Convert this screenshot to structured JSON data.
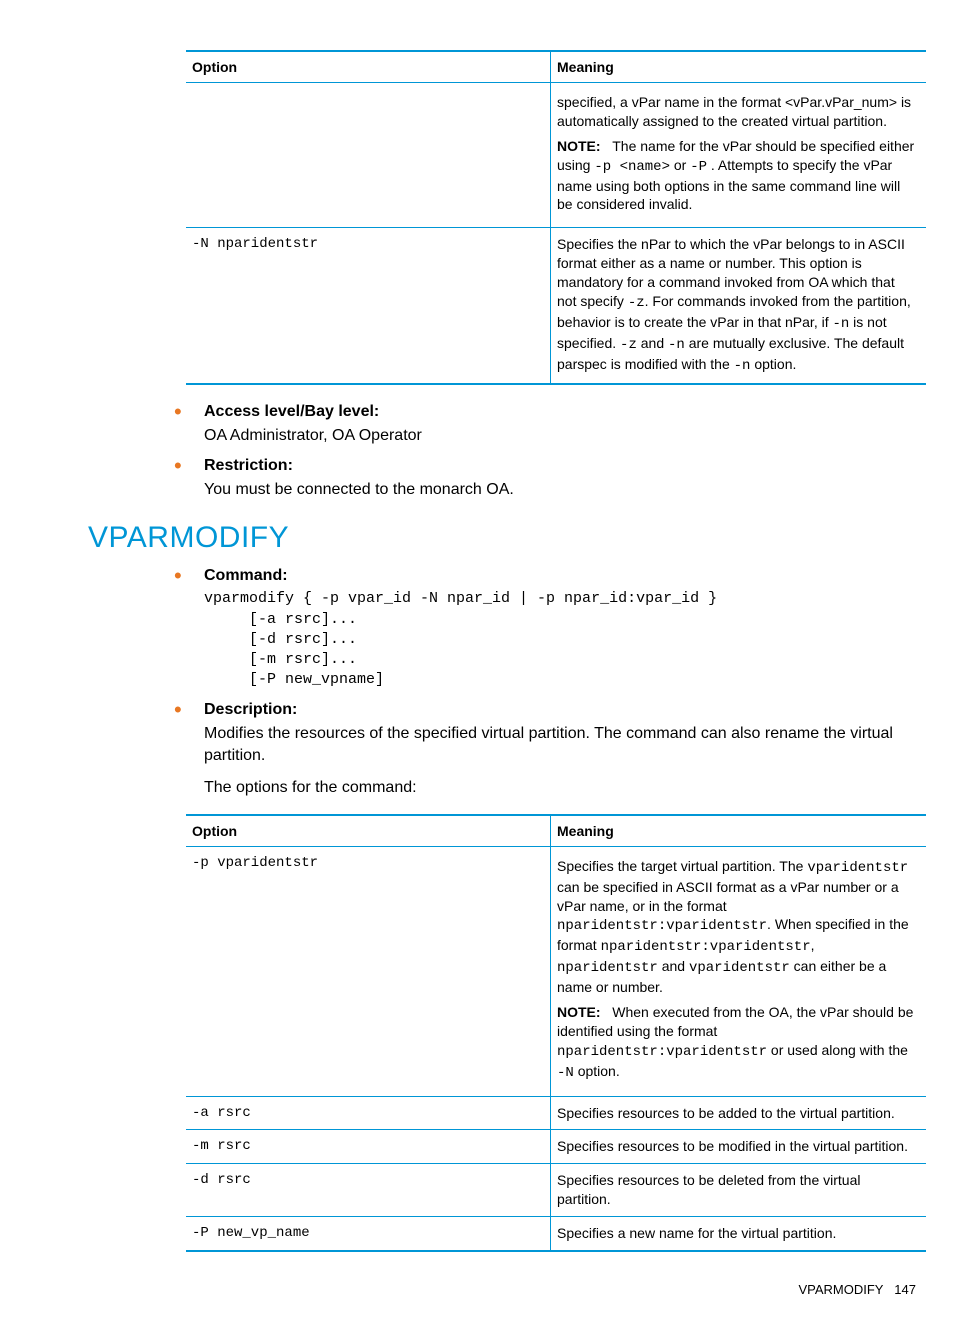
{
  "table1": {
    "headers": {
      "option": "Option",
      "meaning": "Meaning"
    },
    "rows": [
      {
        "option": "",
        "meaning_pre": "specified, a vPar name in the format <vPar.vPar_num> is automatically assigned to the created virtual partition.",
        "note_label": "NOTE:",
        "note_text1": "The name for the vPar should be specified either using ",
        "note_code1": "-p <name>",
        "note_text2": " or ",
        "note_code2": "-P",
        "note_text3": " . Attempts to specify the vPar name using both options in the same command line will be considered invalid."
      },
      {
        "option": "-N nparidentstr",
        "t1": "Specifies the nPar to which the vPar belongs to in ASCII format either as a name or number. This option is mandatory for a command invoked from OA which that not specify ",
        "c1": "-z",
        "t2": ". For commands invoked from the partition, behavior is to create the vPar in that nPar, if ",
        "c2": "-n",
        "t3": " is not specified. ",
        "c3": "-z",
        "t4": " and ",
        "c4": "-n",
        "t5": " are mutually exclusive. The default parspec is modified with the ",
        "c5": "-n",
        "t6": " option."
      }
    ]
  },
  "bullets1": [
    {
      "title": "Access level/Bay level:",
      "body": "OA Administrator, OA Operator"
    },
    {
      "title": "Restriction:",
      "body": "You must be connected to the monarch OA."
    }
  ],
  "section_heading": "VPARMODIFY",
  "bullets2": {
    "command": {
      "title": "Command:",
      "code": "vparmodify { -p vpar_id -N npar_id | -p npar_id:vpar_id }\n     [-a rsrc]...\n     [-d rsrc]...\n     [-m rsrc]...\n     [-P new_vpname]"
    },
    "description": {
      "title": "Description:",
      "p1": "Modifies the resources of the specified virtual partition. The command can also rename the virtual partition.",
      "p2": "The options for the command:"
    }
  },
  "table2": {
    "headers": {
      "option": "Option",
      "meaning": "Meaning"
    },
    "rows": [
      {
        "option": "-p vparidentstr",
        "t1": "Specifies the target virtual partition. The ",
        "c1": "vparidentstr",
        "t2": " can be specified in ASCII format as a vPar number or a vPar name, or in the format ",
        "c2": "nparidentstr:vparidentstr",
        "t3": ". When specified in the format ",
        "c3": "nparidentstr:vparidentstr",
        "t4": ", ",
        "c4": "nparidentstr",
        "t5": " and ",
        "c5": "vparidentstr",
        "t6": " can either be a name or number.",
        "note_label": "NOTE:",
        "n1": "When executed from the OA, the vPar should be identified using the format ",
        "nc1": "nparidentstr:vparidentstr",
        "n2": " or used along with the ",
        "nc2": "-N",
        "n3": " option."
      },
      {
        "option": "-a rsrc",
        "meaning": "Specifies resources to be added to the virtual partition."
      },
      {
        "option": "-m rsrc",
        "meaning": "Specifies resources to be modified in the virtual partition."
      },
      {
        "option": "-d rsrc",
        "meaning": "Specifies resources to be deleted from the virtual partition."
      },
      {
        "option": "-P new_vp_name",
        "meaning": "Specifies a new name for the virtual partition."
      }
    ]
  },
  "footer": {
    "label": "VPARMODIFY",
    "page": "147"
  }
}
